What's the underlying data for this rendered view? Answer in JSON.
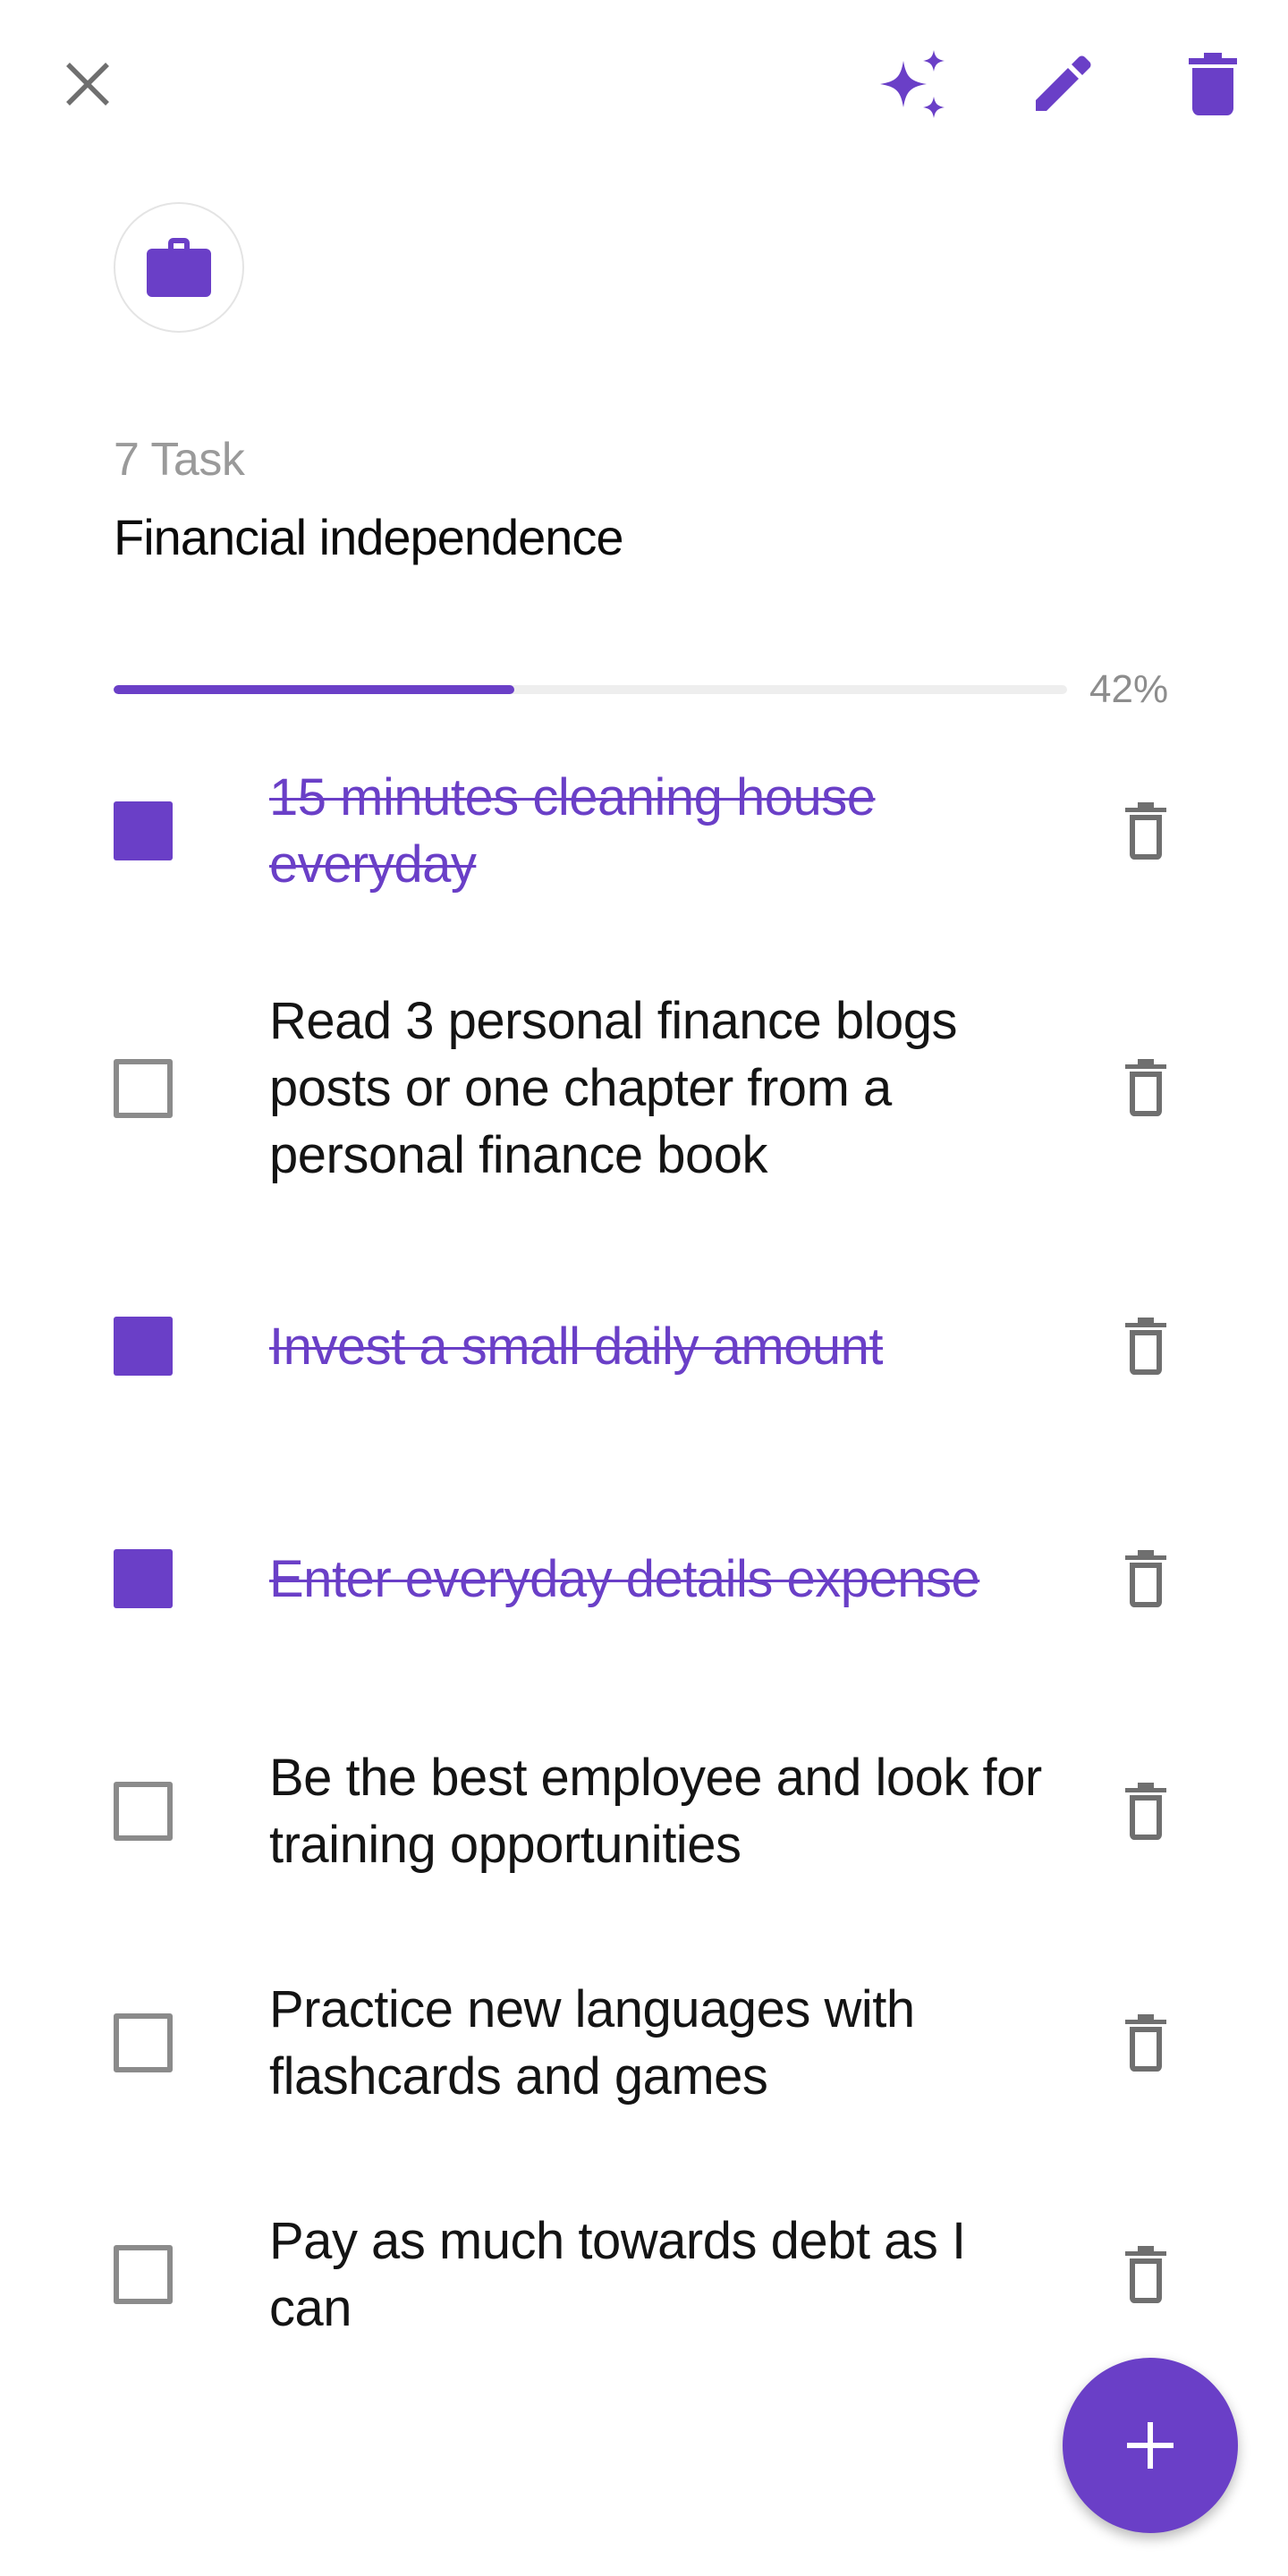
{
  "header": {
    "close_icon": "close-icon",
    "sparkle_icon": "sparkle-icon",
    "edit_icon": "pencil-icon",
    "delete_icon": "trash-icon"
  },
  "category": {
    "icon": "briefcase-icon"
  },
  "list": {
    "task_count": "7 Task",
    "title": "Financial independence",
    "progress_label": "42%",
    "progress_fraction": 0.42
  },
  "tasks": [
    {
      "text": "15 minutes cleaning house everyday ",
      "done": true
    },
    {
      "text": "Read 3 personal finance blogs posts or one chapter from a personal finance book",
      "done": false
    },
    {
      "text": "Invest a small daily amount",
      "done": true
    },
    {
      "text": "Enter everyday details expense ",
      "done": true
    },
    {
      "text": "Be the best employee and look for training opportunities",
      "done": false
    },
    {
      "text": "Practice new languages with flashcards and games",
      "done": false
    },
    {
      "text": "Pay as much towards debt as I can",
      "done": false
    }
  ],
  "fab": {
    "icon": "plus-icon"
  },
  "colors": {
    "accent": "#6a3fc7",
    "icon_gray": "#6f6f6f",
    "checkbox_border": "#8b8b8b",
    "muted_text": "#9a9a9a"
  }
}
